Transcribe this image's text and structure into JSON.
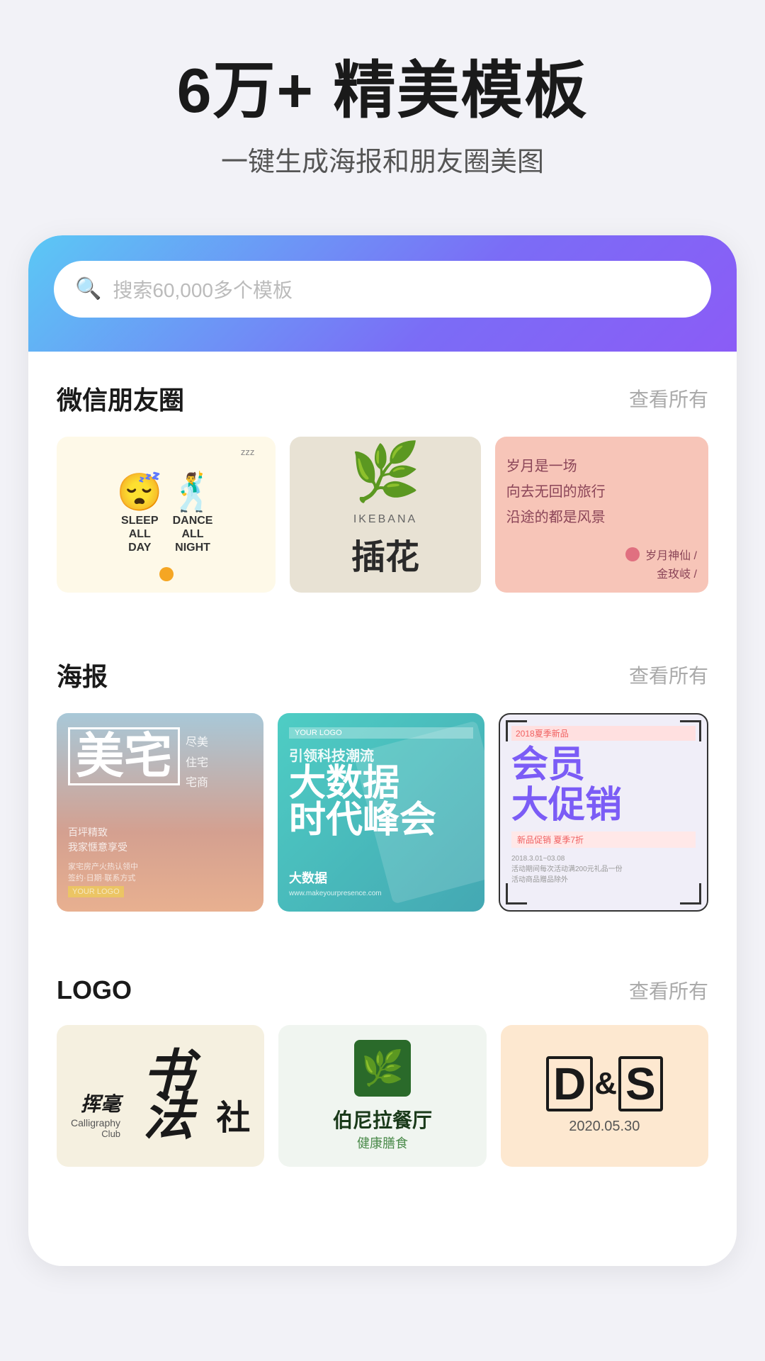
{
  "hero": {
    "title": "6万+ 精美模板",
    "subtitle": "一键生成海报和朋友圈美图"
  },
  "search": {
    "placeholder": "搜索60,000多个模板"
  },
  "sections": {
    "wechat": {
      "title": "微信朋友圈",
      "more": "查看所有",
      "cards": [
        {
          "type": "sleep-dance",
          "text1_line1": "SLEEP",
          "text1_line2": "ALL",
          "text1_line3": "DAY",
          "text2_line1": "DANCE",
          "text2_line2": "ALL",
          "text2_line3": "NIGHT"
        },
        {
          "type": "ikebana",
          "en_label": "IKEBANA",
          "zh_label": "插花"
        },
        {
          "type": "poem",
          "text": "岁月是一场\n向去无回的旅行\n沿途的都是风景",
          "sub1": "岁月神仙 /",
          "sub2": "金玫岐 /"
        }
      ]
    },
    "poster": {
      "title": "海报",
      "more": "查看所有",
      "cards": [
        {
          "type": "real-estate",
          "main_zh": "美宅",
          "sub1": "尽美\n住宅\n宅商",
          "sub2": "百坪精致\n我家惬意享受",
          "bottom": "家宅房产火热认领中",
          "logo": "YOUR LOGO",
          "date": "签约·日期·联系方式"
        },
        {
          "type": "tech-summit",
          "logo": "YOUR LOGO",
          "title_zh": "大数据",
          "title_zh2": "时代峰会",
          "sub_zh": "引领科技潮流",
          "en_label": "大数据",
          "bottom_en": "www.makeyourpresence.com"
        },
        {
          "type": "membership",
          "year": "2018夏季新品",
          "title": "会员\n大促销",
          "date_range": "2018.3.01~03.08",
          "promo": "新品促销 夏季7折",
          "detail": "活动期间每次活动满200元礼品一份\n活动商品赠品除外"
        }
      ]
    },
    "logo": {
      "title": "LOGO",
      "more": "查看所有",
      "cards": [
        {
          "type": "calligraphy",
          "zh1": "挥毫",
          "zh2": "书法",
          "en1": "Calligraphy",
          "en2": "Club",
          "zh3": "社"
        },
        {
          "type": "restaurant",
          "name": "伯尼拉餐厅",
          "sub": "健康膳食"
        },
        {
          "type": "ds-logo",
          "text": "D&S",
          "date": "2020.05.30"
        }
      ]
    }
  }
}
